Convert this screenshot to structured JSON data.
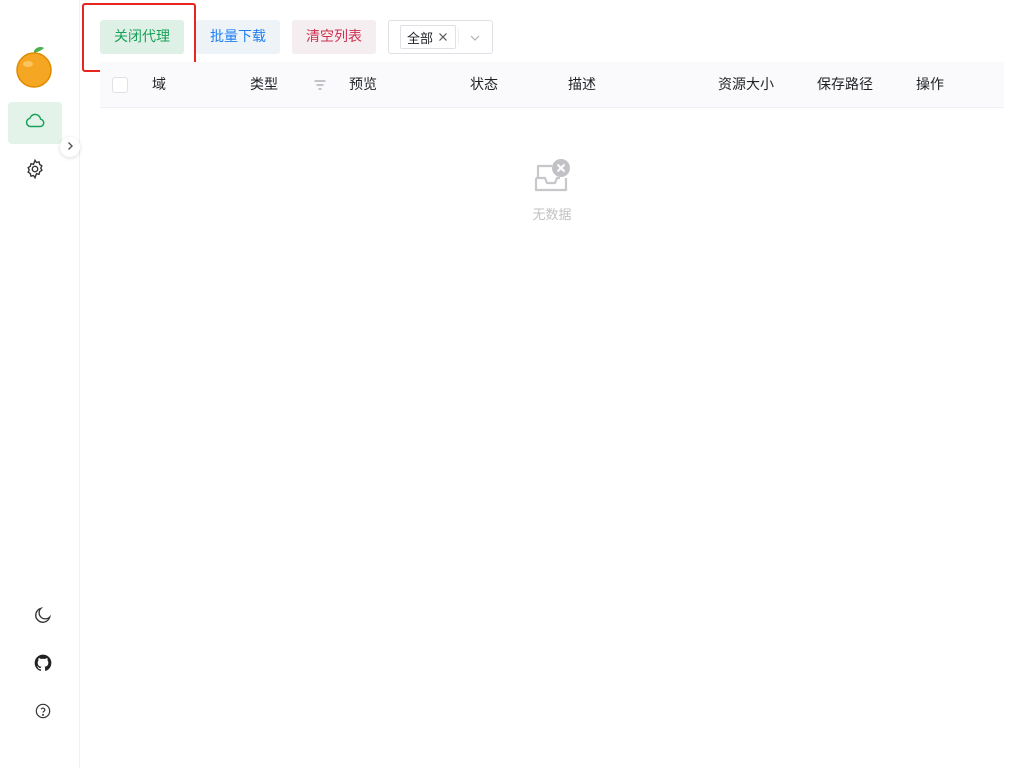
{
  "window_controls": [
    "close",
    "minimize",
    "maximize"
  ],
  "sidebar": {
    "logo_icon": "orange-fruit-icon",
    "nav": [
      {
        "icon": "cloud-icon",
        "active": true
      },
      {
        "icon": "gear-icon",
        "active": false
      }
    ],
    "collapse_icon": "chevron-right-icon",
    "bottom": [
      "moon-icon",
      "github-icon",
      "help-icon"
    ]
  },
  "toolbar": {
    "proxy_label": "关闭代理",
    "download_label": "批量下载",
    "clear_label": "清空列表",
    "filter_tag": "全部"
  },
  "table": {
    "columns": [
      "域",
      "类型",
      "预览",
      "状态",
      "描述",
      "资源大小",
      "保存路径",
      "操作"
    ],
    "empty_text": "无数据"
  },
  "colors": {
    "accent_green": "#18a058",
    "info_blue": "#2080f0",
    "error_red": "#d03050",
    "highlight_red": "#e8251f"
  }
}
